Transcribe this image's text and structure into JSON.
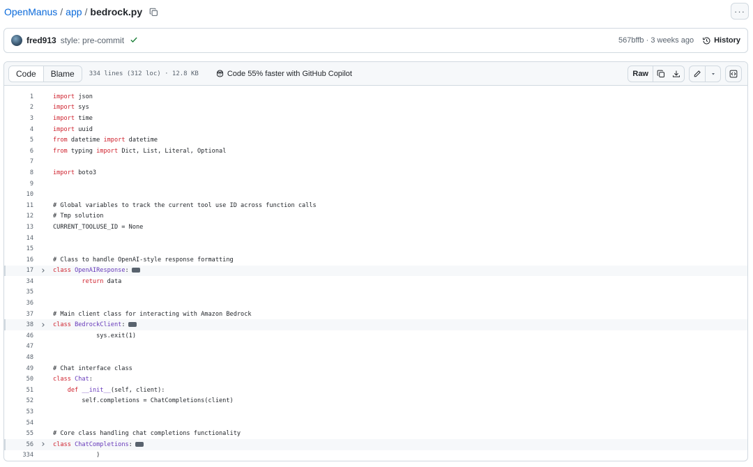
{
  "breadcrumb": {
    "repo": "OpenManus",
    "sep1": "/",
    "folder": "app",
    "sep2": "/",
    "file": "bedrock.py"
  },
  "commit": {
    "author": "fred913",
    "message": "style: pre-commit",
    "hash_time": "567bffb · 3 weeks ago",
    "history_label": "History"
  },
  "file_header": {
    "tab_code": "Code",
    "tab_blame": "Blame",
    "info": "334 lines (312 loc) · 12.8 KB",
    "copilot": "Code 55% faster with GitHub Copilot",
    "raw": "Raw"
  },
  "colors": {
    "link": "#0969da",
    "keyword": "#cf222e",
    "class_name": "#6639ba",
    "success": "#1a7f37"
  },
  "code_lines": [
    {
      "n": "1",
      "text": "import json"
    },
    {
      "n": "2",
      "text": "import sys"
    },
    {
      "n": "3",
      "text": "import time"
    },
    {
      "n": "4",
      "text": "import uuid"
    },
    {
      "n": "5",
      "text": "from datetime import datetime"
    },
    {
      "n": "6",
      "text": "from typing import Dict, List, Literal, Optional"
    },
    {
      "n": "7",
      "text": ""
    },
    {
      "n": "8",
      "text": "import boto3"
    },
    {
      "n": "9",
      "text": ""
    },
    {
      "n": "10",
      "text": ""
    },
    {
      "n": "11",
      "text": "# Global variables to track the current tool use ID across function calls"
    },
    {
      "n": "12",
      "text": "# Tmp solution"
    },
    {
      "n": "13",
      "text": "CURRENT_TOOLUSE_ID = None"
    },
    {
      "n": "14",
      "text": ""
    },
    {
      "n": "15",
      "text": ""
    },
    {
      "n": "16",
      "text": "# Class to handle OpenAI-style response formatting"
    },
    {
      "n": "17",
      "text": "class OpenAIResponse:",
      "folded": true
    },
    {
      "n": "34",
      "text": "        return data"
    },
    {
      "n": "35",
      "text": ""
    },
    {
      "n": "36",
      "text": ""
    },
    {
      "n": "37",
      "text": "# Main client class for interacting with Amazon Bedrock"
    },
    {
      "n": "38",
      "text": "class BedrockClient:",
      "folded": true
    },
    {
      "n": "46",
      "text": "            sys.exit(1)"
    },
    {
      "n": "47",
      "text": ""
    },
    {
      "n": "48",
      "text": ""
    },
    {
      "n": "49",
      "text": "# Chat interface class"
    },
    {
      "n": "50",
      "text": "class Chat:"
    },
    {
      "n": "51",
      "text": "    def __init__(self, client):"
    },
    {
      "n": "52",
      "text": "        self.completions = ChatCompletions(client)"
    },
    {
      "n": "53",
      "text": ""
    },
    {
      "n": "54",
      "text": ""
    },
    {
      "n": "55",
      "text": "# Core class handling chat completions functionality"
    },
    {
      "n": "56",
      "text": "class ChatCompletions:",
      "folded": true
    },
    {
      "n": "334",
      "text": "            )"
    }
  ]
}
